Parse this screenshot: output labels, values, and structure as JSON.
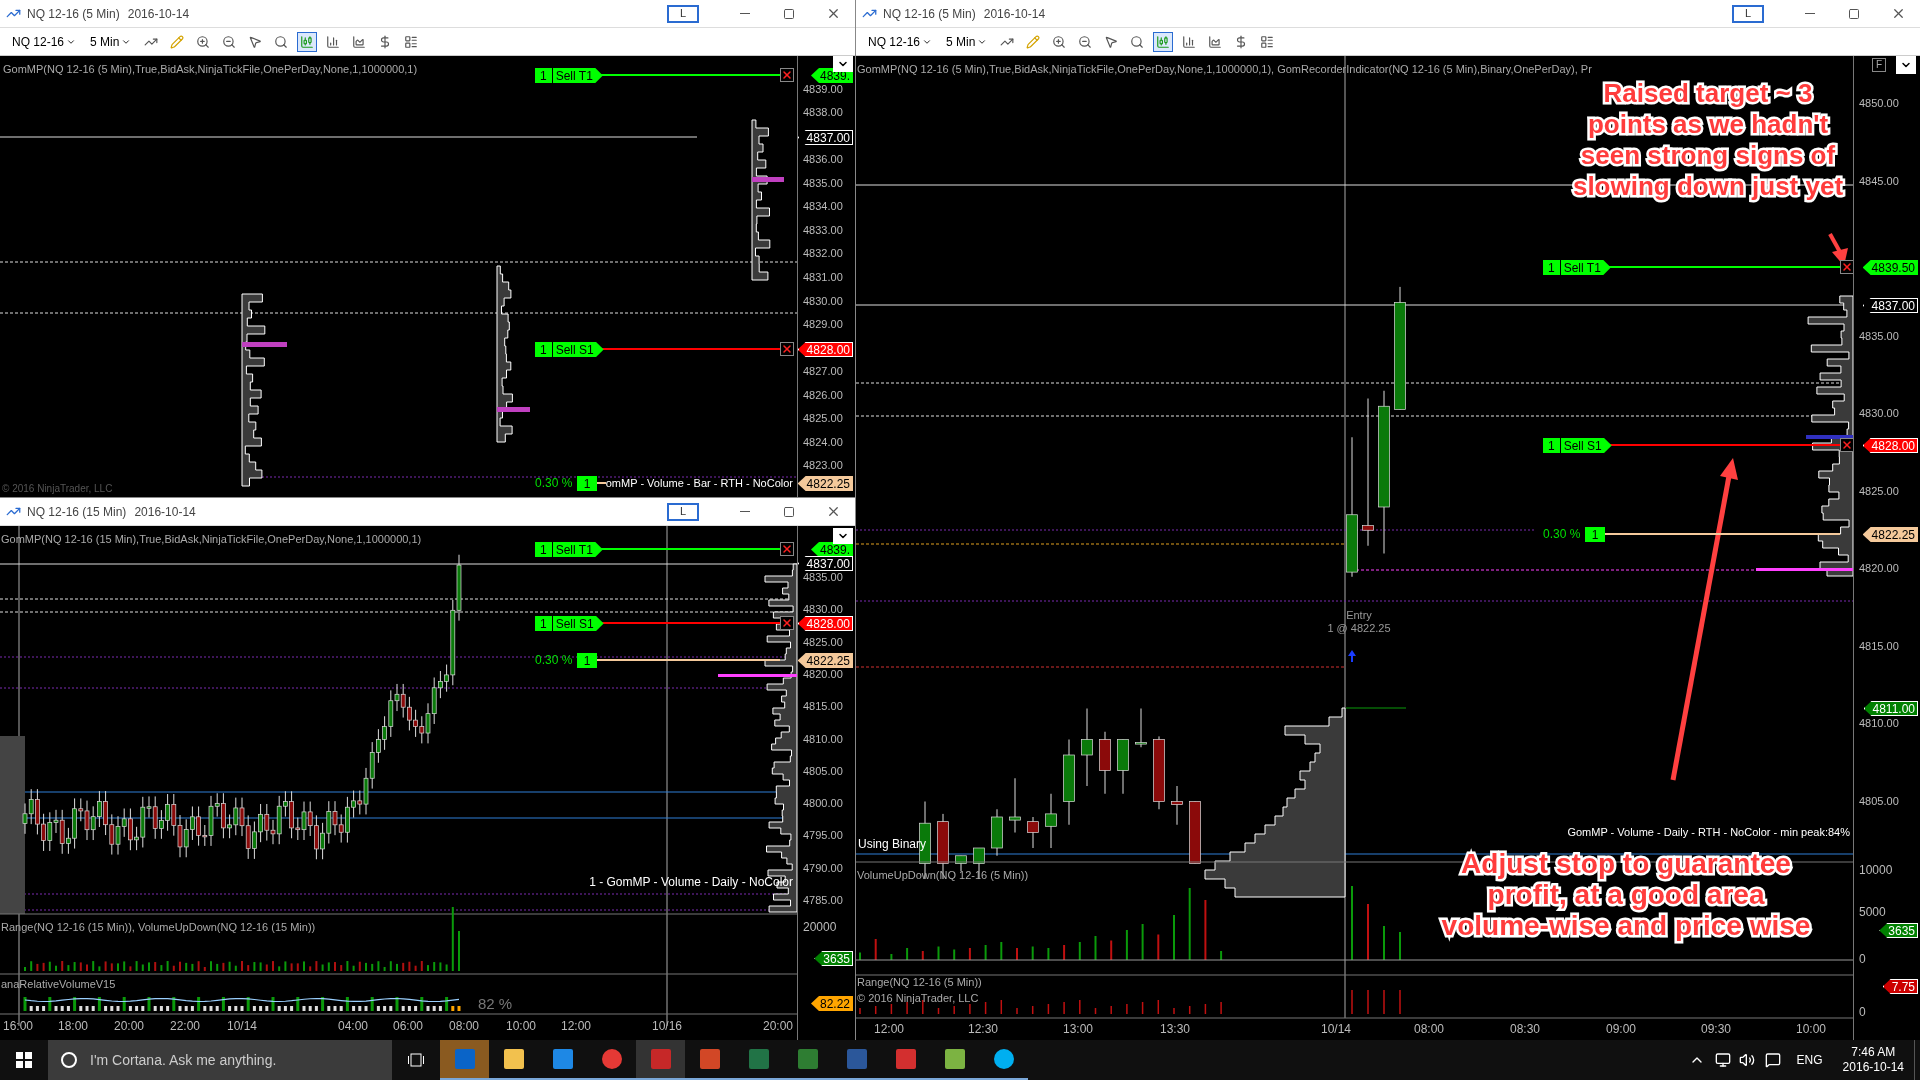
{
  "charts": [
    {
      "title": "NQ 12-16 (5 Min)",
      "date": "2016-10-14",
      "layout_button": "L",
      "toolbar": {
        "instrument": "NQ 12-16",
        "interval": "5 Min"
      },
      "indicator": "GomMP(NQ 12-16 (5 Min),True,BidAsk,NinjaTickFile,OnePerDay,None,1,1000000,1)",
      "price_axis": [
        "4839.00",
        "4838.00",
        "4836.00",
        "4835.00",
        "4834.00",
        "4833.00",
        "4832.00",
        "4831.00",
        "4830.00",
        "4829.00",
        "4827.00",
        "4826.00",
        "4825.00",
        "4824.00",
        "4823.00"
      ],
      "price_tags": [
        {
          "text": "4839.",
          "color": "#00ff00"
        },
        {
          "text": "4837.00",
          "color": "#000000"
        },
        {
          "text": "4828.00",
          "color": "#ff0000"
        },
        {
          "text": "4822.25",
          "color": "#f4c99b"
        }
      ],
      "orders": [
        {
          "kind": "target",
          "quantity": "1",
          "label": "Sell T1",
          "color": "#00ff00"
        },
        {
          "kind": "stop",
          "quantity": "1",
          "label": "Sell S1",
          "color": "#ff0000"
        },
        {
          "kind": "position",
          "quantity": "1",
          "label": "0.30 %",
          "color": "#f4c99b"
        }
      ],
      "notes": [
        "omMP - Volume - Bar - RTH - NoColor",
        "© 2016 NinjaTrader, LLC"
      ]
    },
    {
      "title": "NQ 12-16 (15 Min)",
      "date": "2016-10-14",
      "layout_button": "L",
      "indicator": "GomMP(NQ 12-16 (15 Min),True,BidAsk,NinjaTickFile,OnePerDay,None,1,1000000,1)",
      "price_axis": [
        "4835.00",
        "4830.00",
        "4825.00",
        "4820.00",
        "4815.00",
        "4810.00",
        "4805.00",
        "4800.00",
        "4795.00",
        "4790.00",
        "4785.00"
      ],
      "price_tags": [
        {
          "text": "4839.",
          "color": "#00ff00"
        },
        {
          "text": "4837.00",
          "color": "#000000"
        },
        {
          "text": "4828.00",
          "color": "#ff0000"
        },
        {
          "text": "4822.25",
          "color": "#f4c99b"
        }
      ],
      "orders": [
        {
          "kind": "target",
          "quantity": "1",
          "label": "Sell T1",
          "color": "#00ff00"
        },
        {
          "kind": "stop",
          "quantity": "1",
          "label": "Sell S1",
          "color": "#ff0000"
        },
        {
          "kind": "position",
          "quantity": "1",
          "label": "0.30 %",
          "color": "#f4c99b"
        }
      ],
      "notes": [
        "1 - GomMP - Volume - Daily - NoColor"
      ],
      "panels": [
        {
          "title": "Range(NQ 12-16 (15 Min)), VolumeUpDown(NQ 12-16 (15 Min))",
          "axis": [
            "20000"
          ],
          "tags": [
            {
              "text": "3635",
              "color": "#008000"
            }
          ]
        },
        {
          "title": "anaRelativeVolumeV15",
          "reading": "82 %",
          "tags": [
            {
              "text": "82.22",
              "color": "#ffa500"
            }
          ]
        }
      ],
      "time_axis": [
        "16:00",
        "18:00",
        "20:00",
        "22:00",
        "10/14",
        "04:00",
        "06:00",
        "08:00",
        "10:00",
        "12:00",
        "10/16",
        "20:00"
      ]
    },
    {
      "title": "NQ 12-16 (5 Min)",
      "date": "2016-10-14",
      "layout_button": "L",
      "toolbar": {
        "instrument": "NQ 12-16",
        "interval": "5 Min"
      },
      "corner_label": "F",
      "indicator": "GomMP(NQ 12-16 (5 Min),True,BidAsk,NinjaTickFile,OnePerDay,None,1,1000000,1), GomRecorderIndicator(NQ 12-16 (5 Min),Binary,OnePerDay), Pr",
      "price_axis": [
        "4850.00",
        "4845.00",
        "4835.00",
        "4830.00",
        "4825.00",
        "4820.00",
        "4815.00",
        "4810.00",
        "4805.00"
      ],
      "price_tags": [
        {
          "text": "4839.50",
          "color": "#00ff00"
        },
        {
          "text": "4837.00",
          "color": "#000000"
        },
        {
          "text": "4828.00",
          "color": "#ff0000"
        },
        {
          "text": "4822.25",
          "color": "#f4c99b"
        },
        {
          "text": "4811.00",
          "color": "#008000"
        }
      ],
      "orders": [
        {
          "kind": "target",
          "quantity": "1",
          "label": "Sell T1",
          "color": "#00ff00"
        },
        {
          "kind": "stop",
          "quantity": "1",
          "label": "Sell S1",
          "color": "#ff0000"
        },
        {
          "kind": "position",
          "quantity": "1",
          "label": "0.30 %",
          "color": "#f4c99b"
        }
      ],
      "notes": [
        "Entry",
        "1 @ 4822.25",
        "Using Binary",
        "GomMP - Volume - Daily - RTH - NoColor - min peak:84%"
      ],
      "panels": [
        {
          "title": "VolumeUpDown(NQ 12-16 (5 Min))",
          "axis": [
            "10000",
            "5000",
            "0"
          ],
          "tags": [
            {
              "text": "3635",
              "color": "#008000"
            }
          ]
        },
        {
          "title": "Range(NQ 12-16 (5 Min))",
          "subtitle": "© 2016 NinjaTrader, LLC",
          "axis": [
            "0"
          ],
          "tags": [
            {
              "text": "7.75",
              "color": "#cc0000"
            }
          ]
        }
      ],
      "time_axis": [
        "12:00",
        "12:30",
        "13:00",
        "13:30",
        "10/14",
        "08:00",
        "08:30",
        "09:00",
        "09:30",
        "10:00"
      ],
      "annotations": [
        "Raised target ~ 3 points as we hadn't seen strong signs of slowing down just yet",
        "Adjust stop to guarantee profit, at a good area volume-wise and price wise"
      ]
    }
  ],
  "taskbar": {
    "search_placeholder": "I'm Cortana. Ask me anything.",
    "language": "ENG",
    "time": "7:46 AM",
    "date": "2016-10-14"
  }
}
